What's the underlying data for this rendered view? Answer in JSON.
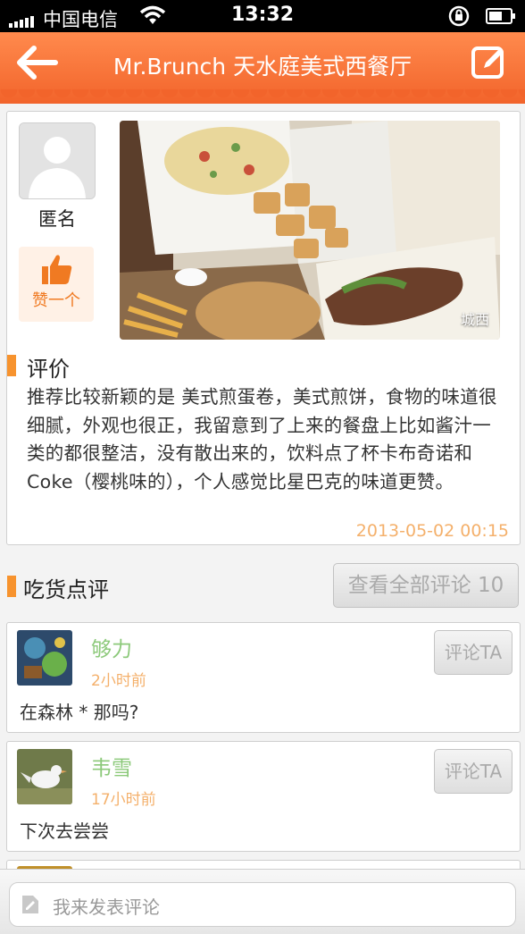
{
  "status_bar": {
    "carrier": "中国电信",
    "time": "13:32"
  },
  "nav": {
    "title": "Mr.Brunch 天水庭美式西餐厅",
    "back_icon": "back-arrow-icon",
    "edit_icon": "edit-icon"
  },
  "post": {
    "author": "匿名",
    "like_label": "赞一个",
    "photo_location": "城西",
    "review_section_title": "评价",
    "review_text": "推荐比较新颖的是 美式煎蛋卷，美式煎饼，食物的味道很细腻，外观也很正，我留意到了上来的餐盘上比如酱汁一类的都很整洁，没有散出来的，饮料点了杯卡布奇诺和Coke（樱桃味的），个人感觉比星巴克的味道更赞。",
    "date": "2013-05-02 00:15"
  },
  "comments_section": {
    "title": "吃货点评",
    "view_all_label": "查看全部评论 10",
    "reply_label": "评论TA",
    "items": [
      {
        "name": "够力",
        "time": "2小时前",
        "text": "在森林 * 那吗?"
      },
      {
        "name": "韦雪",
        "time": "17小时前",
        "text": "下次去尝尝"
      }
    ]
  },
  "composer": {
    "placeholder": "我来发表评论"
  },
  "colors": {
    "accent": "#f2642b",
    "username": "#8cc97a",
    "timestamp": "#f4b06b",
    "section_marker": "#f7932e"
  }
}
